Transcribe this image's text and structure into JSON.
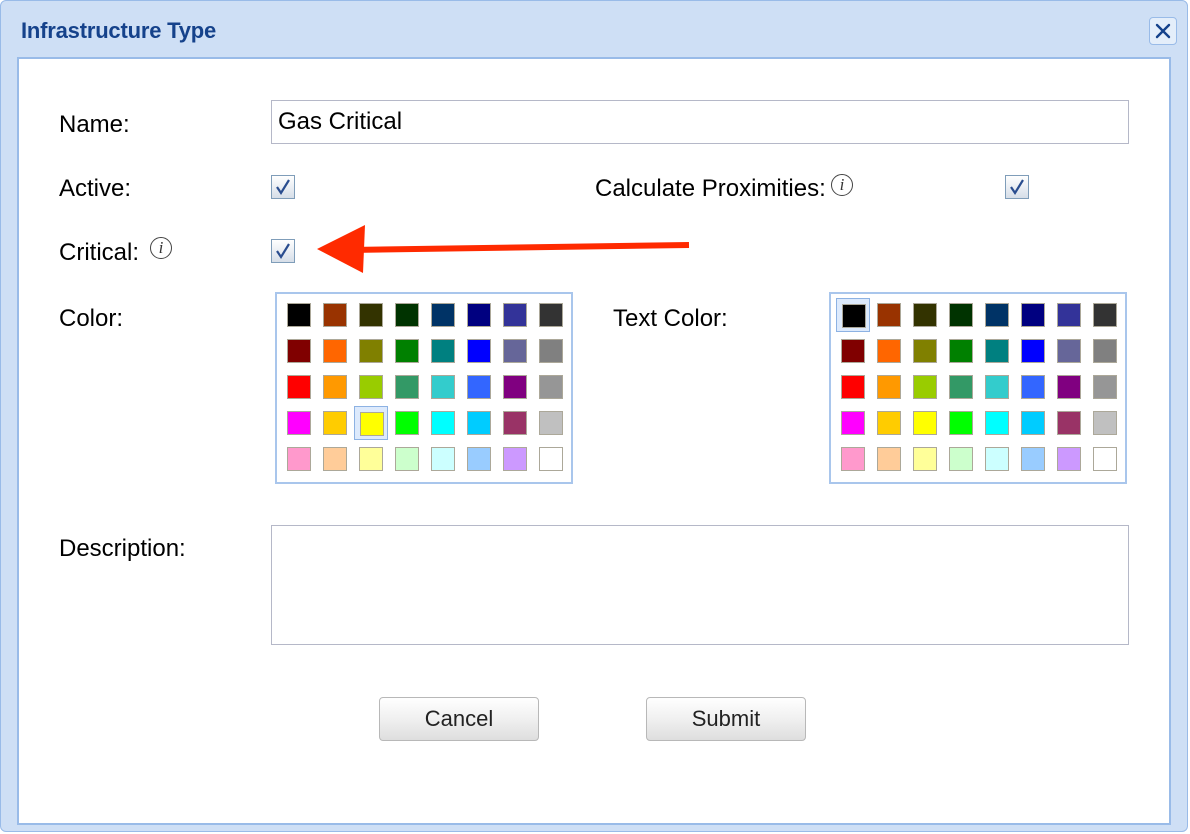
{
  "window": {
    "title": "Infrastructure Type"
  },
  "form": {
    "name_label": "Name:",
    "name_value": "Gas Critical",
    "active_label": "Active:",
    "calculate_proximities_label": "Calculate Proximities:",
    "critical_label": "Critical:",
    "color_label": "Color:",
    "text_color_label": "Text Color:",
    "description_label": "Description:",
    "description_value": "",
    "active_checked": true,
    "calculate_proximities_checked": true,
    "critical_checked": true
  },
  "palette_colors": [
    [
      "#000000",
      "#993300",
      "#333300",
      "#003300",
      "#003366",
      "#000080",
      "#333399",
      "#333333"
    ],
    [
      "#800000",
      "#FF6600",
      "#808000",
      "#008000",
      "#008080",
      "#0000FF",
      "#666699",
      "#808080"
    ],
    [
      "#FF0000",
      "#FF9900",
      "#99CC00",
      "#339966",
      "#33CCCC",
      "#3366FF",
      "#800080",
      "#969696"
    ],
    [
      "#FF00FF",
      "#FFCC00",
      "#FFFF00",
      "#00FF00",
      "#00FFFF",
      "#00CCFF",
      "#993366",
      "#C0C0C0"
    ],
    [
      "#FF99CC",
      "#FFCC99",
      "#FFFF99",
      "#CCFFCC",
      "#CCFFFF",
      "#99CCFF",
      "#CC99FF",
      "#FFFFFF"
    ]
  ],
  "color_selected": "#FFFF00",
  "text_color_selected": "#000000",
  "annotation": {
    "arrow_color": "#FF2A00"
  },
  "buttons": {
    "cancel": "Cancel",
    "submit": "Submit"
  }
}
